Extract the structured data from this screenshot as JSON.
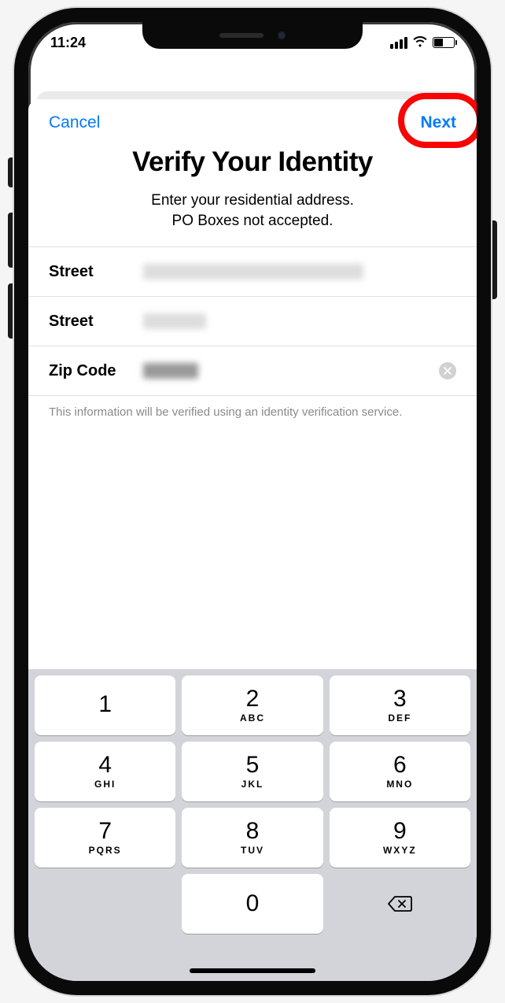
{
  "status_bar": {
    "time": "11:24"
  },
  "nav": {
    "cancel": "Cancel",
    "next": "Next"
  },
  "header": {
    "title": "Verify Your Identity",
    "subtitle_line1": "Enter your residential address.",
    "subtitle_line2": "PO Boxes not accepted."
  },
  "fields": {
    "street1_label": "Street",
    "street2_label": "Street",
    "zip_label": "Zip Code"
  },
  "footer_note": "This information will be verified using an identity verification service.",
  "keypad": {
    "keys": [
      {
        "num": "1",
        "letters": ""
      },
      {
        "num": "2",
        "letters": "ABC"
      },
      {
        "num": "3",
        "letters": "DEF"
      },
      {
        "num": "4",
        "letters": "GHI"
      },
      {
        "num": "5",
        "letters": "JKL"
      },
      {
        "num": "6",
        "letters": "MNO"
      },
      {
        "num": "7",
        "letters": "PQRS"
      },
      {
        "num": "8",
        "letters": "TUV"
      },
      {
        "num": "9",
        "letters": "WXYZ"
      },
      {
        "num": "0",
        "letters": ""
      }
    ]
  },
  "annotation": {
    "highlight": "next-button"
  }
}
